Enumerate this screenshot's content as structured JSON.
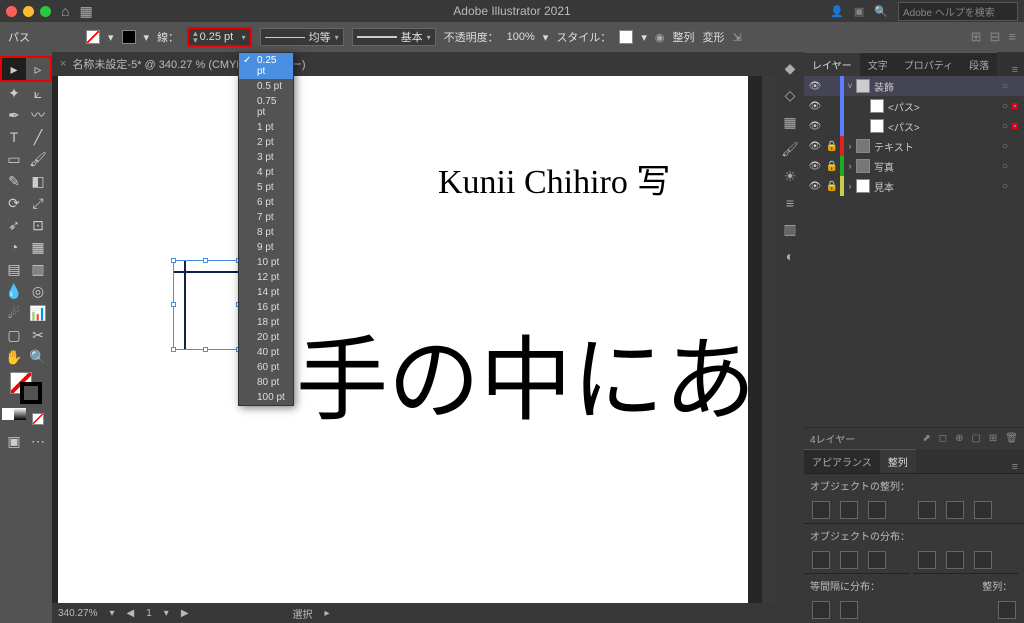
{
  "app_title": "Adobe Illustrator 2021",
  "search_placeholder": "Adobe ヘルプを検索",
  "controlbar": {
    "label_path": "パス",
    "stroke_label": "線：",
    "stroke_value": "0.25 pt",
    "profile_label": "均等",
    "brush_label": "基本",
    "opacity_label": "不透明度：",
    "opacity_value": "100%",
    "style_label": "スタイル：",
    "align_label": "整列",
    "transform_label": "変形"
  },
  "doc_tab": "名称未設定-5* @ 340.27 % (CMYK/プレビュー)",
  "canvas_text1": "Kunii Chihiro 写",
  "canvas_text2": "手の中にあ",
  "stroke_options": [
    "0.25 pt",
    "0.5 pt",
    "0.75 pt",
    "1 pt",
    "2 pt",
    "3 pt",
    "4 pt",
    "5 pt",
    "6 pt",
    "7 pt",
    "8 pt",
    "9 pt",
    "10 pt",
    "12 pt",
    "14 pt",
    "16 pt",
    "18 pt",
    "20 pt",
    "40 pt",
    "60 pt",
    "80 pt",
    "100 pt"
  ],
  "status": {
    "zoom": "340.27%",
    "page": "1",
    "tool": "選択"
  },
  "panel_tabs": {
    "layers": "レイヤー",
    "text": "文字",
    "prop": "プロパティ",
    "cc": "段落"
  },
  "layers": {
    "rows": [
      {
        "name": "装飾",
        "color": "#5a7fff",
        "exp": "˅",
        "sel": true,
        "indent": 0,
        "thumb": "#ccc"
      },
      {
        "name": "<パス>",
        "color": "#5a7fff",
        "exp": "",
        "sel": false,
        "indent": 1,
        "thumb": "#fff",
        "hot": true
      },
      {
        "name": "<パス>",
        "color": "#5a7fff",
        "exp": "",
        "sel": false,
        "indent": 1,
        "thumb": "#fff",
        "hot": true
      },
      {
        "name": "テキスト",
        "color": "#d22",
        "exp": "›",
        "sel": false,
        "indent": 0,
        "thumb": "#777",
        "lock": true
      },
      {
        "name": "写真",
        "color": "#2a2",
        "exp": "›",
        "sel": false,
        "indent": 0,
        "thumb": "#777",
        "lock": true
      },
      {
        "name": "見本",
        "color": "#cc4",
        "exp": "›",
        "sel": false,
        "indent": 0,
        "thumb": "#fff",
        "lock": true
      }
    ],
    "footer": "4レイヤー"
  },
  "appearance_tab": "アピアランス",
  "align_tab": "整列",
  "align_headings": {
    "obj": "オブジェクトの整列：",
    "dist": "オブジェクトの分布：",
    "space": "等間隔に分布：",
    "to": "整列："
  }
}
